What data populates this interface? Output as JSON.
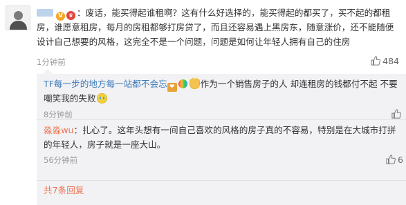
{
  "main_comment": {
    "text": "：废话，能买得起谁租啊？这有什么好选择的，能买得起的都买了，买不起的都租房，谁愿意租房，每月的房租都够打房贷了，而且还容易遇上黑房东，随意涨价，还不能随便设计自己想要的风格，这完全不是一个问题，问题是如何让年轻人拥有自己的住房",
    "time": "1分钟前",
    "likes": "484"
  },
  "replies": [
    {
      "username": "TF每一步的地方每一站都不会忘",
      "text": "作为一个销售房子的人 却连租房的钱都付不起 不要嘲笑我的失败",
      "time": "8分钟前",
      "likes": ""
    },
    {
      "username": "淼淼wu",
      "text": "：扎心了。这年头想有一间自己喜欢的风格的房子真的不容易，特别是在大城市打拼的年轻人，房子就是一座大山。",
      "time": "56分钟前",
      "likes": "6"
    }
  ],
  "more_replies": "共7条回复",
  "colors": {
    "link_orange": "#eb7350",
    "link_blue": "#3d7ab8",
    "reply_bg": "#f2f2f5",
    "muted": "#999999"
  },
  "icons": [
    "avatar",
    "vip-badge",
    "medal-badge",
    "level-badge",
    "rainbow-badge",
    "cat-emoji",
    "cry-emoji",
    "thumbs-up-icon"
  ]
}
